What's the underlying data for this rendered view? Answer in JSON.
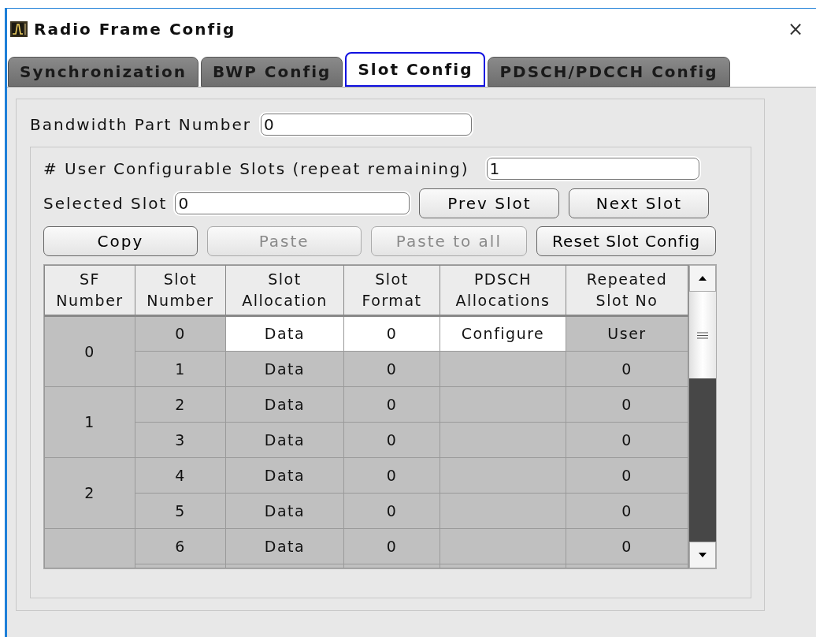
{
  "window": {
    "title": "Radio Frame Config",
    "close": "×"
  },
  "tabs": [
    {
      "label": "Synchronization",
      "selected": false
    },
    {
      "label": "BWP Config",
      "selected": false
    },
    {
      "label": "Slot Config",
      "selected": true
    },
    {
      "label": "PDSCH/PDCCH Config",
      "selected": false
    }
  ],
  "bandwidth_part": {
    "label": "Bandwidth Part Number",
    "value": "0"
  },
  "user_slots": {
    "label": "# User Configurable Slots (repeat remaining)",
    "value": "1"
  },
  "selected_slot": {
    "label": "Selected Slot",
    "value": "0"
  },
  "nav_buttons": [
    {
      "label": "Prev Slot",
      "disabled": false
    },
    {
      "label": "Next Slot",
      "disabled": false
    }
  ],
  "edit_buttons": [
    {
      "label": "Copy",
      "disabled": false
    },
    {
      "label": "Paste",
      "disabled": true
    },
    {
      "label": "Paste to all",
      "disabled": true
    },
    {
      "label": "Reset Slot Config",
      "disabled": false
    }
  ],
  "table": {
    "columns": [
      "SF Number",
      "Slot Number",
      "Slot Allocation",
      "Slot Format",
      "PDSCH Allocations",
      "Repeated Slot No"
    ],
    "groups": [
      {
        "sf": "0",
        "slots": [
          {
            "slot": "0",
            "allocation": "Data",
            "format": "0",
            "pdsch": "Configure",
            "repeated": "User",
            "selected": true
          },
          {
            "slot": "1",
            "allocation": "Data",
            "format": "0",
            "repeated": "0",
            "selected": false
          }
        ]
      },
      {
        "sf": "1",
        "slots": [
          {
            "slot": "2",
            "allocation": "Data",
            "format": "0",
            "repeated": "0",
            "selected": false
          },
          {
            "slot": "3",
            "allocation": "Data",
            "format": "0",
            "repeated": "0",
            "selected": false
          }
        ]
      },
      {
        "sf": "2",
        "slots": [
          {
            "slot": "4",
            "allocation": "Data",
            "format": "0",
            "repeated": "0",
            "selected": false
          },
          {
            "slot": "5",
            "allocation": "Data",
            "format": "0",
            "repeated": "0",
            "selected": false
          }
        ]
      },
      {
        "slots": [
          {
            "slot": "6",
            "allocation": "Data",
            "format": "0",
            "repeated": "0",
            "selected": false
          }
        ]
      }
    ]
  }
}
